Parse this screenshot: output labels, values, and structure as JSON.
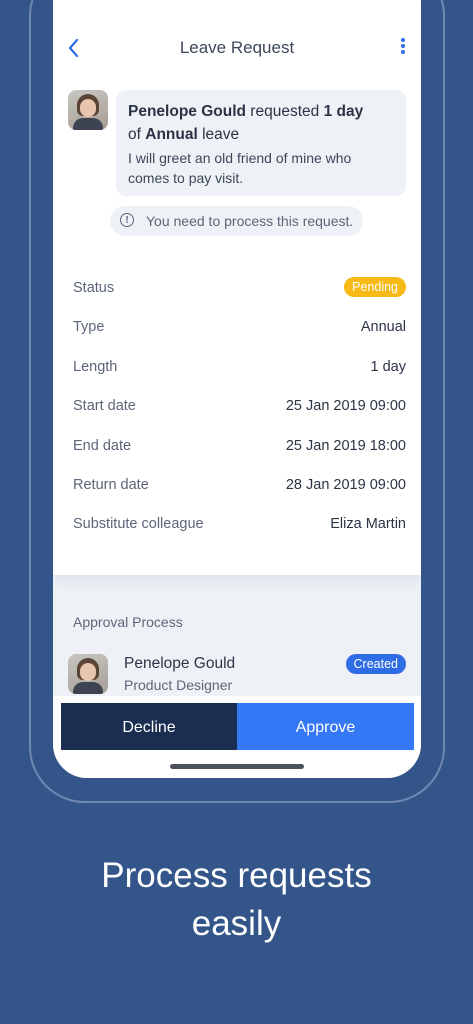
{
  "header": {
    "title": "Leave Request"
  },
  "request": {
    "requester": "Penelope Gould",
    "requested_text": "requested",
    "amount": "1 day",
    "of_text": "of",
    "leave_type": "Annual",
    "leave_word": "leave",
    "message": "I will greet an old friend of mine who comes to pay visit."
  },
  "notice": "You need to process this request.",
  "details": {
    "status": {
      "label": "Status",
      "value": "Pending"
    },
    "type": {
      "label": "Type",
      "value": "Annual"
    },
    "length": {
      "label": "Length",
      "value": "1 day"
    },
    "start": {
      "label": "Start date",
      "value": "25 Jan 2019 09:00"
    },
    "end": {
      "label": "End date",
      "value": "25 Jan 2019 18:00"
    },
    "return": {
      "label": "Return date",
      "value": "28 Jan 2019 09:00"
    },
    "substitute": {
      "label": "Substitute colleague",
      "value": "Eliza Martin"
    }
  },
  "approval": {
    "title": "Approval Process",
    "name": "Penelope Gould",
    "role": "Product Designer",
    "status": "Created"
  },
  "actions": {
    "decline": "Decline",
    "approve": "Approve"
  },
  "caption": {
    "line1": "Process requests",
    "line2": "easily"
  },
  "colors": {
    "background": "#34558a",
    "accent": "#2f6de6",
    "pending": "#f6b916",
    "decline": "#1b2d50",
    "approve": "#3478f6"
  },
  "icons": [
    "back-chevron-icon",
    "more-vertical-icon",
    "info-circle-icon"
  ]
}
